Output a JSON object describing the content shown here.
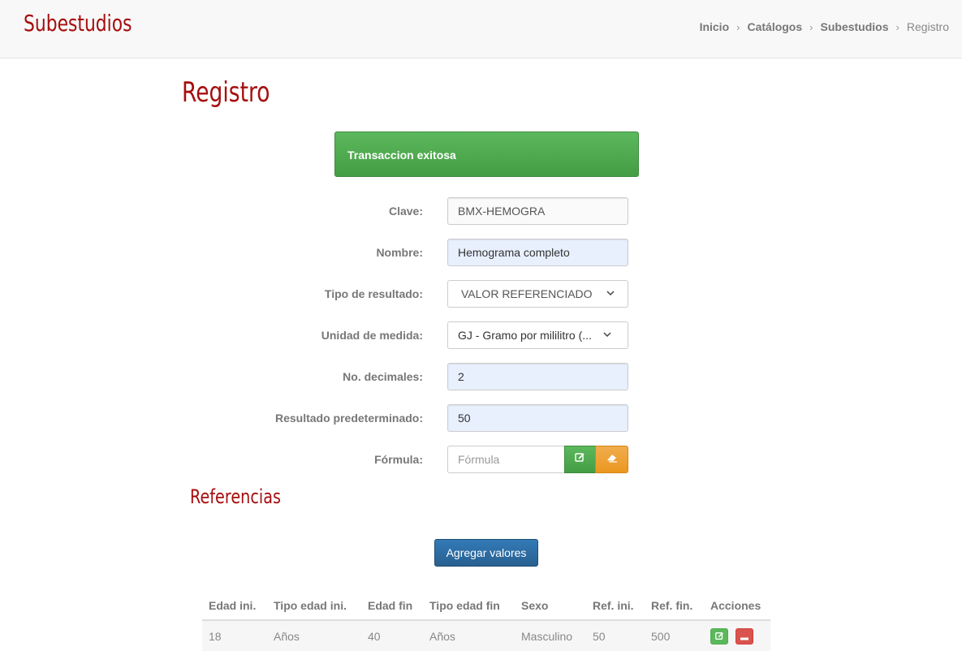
{
  "header": {
    "app_title": "Subestudios",
    "breadcrumb": [
      "Inicio",
      "Catálogos",
      "Subestudios",
      "Registro"
    ]
  },
  "page_title": "Registro",
  "alert": {
    "message": "Transaccion exitosa",
    "color": "#5cb85c"
  },
  "form": {
    "clave": {
      "label": "Clave:",
      "value": "BMX-HEMOGRA"
    },
    "nombre": {
      "label": "Nombre:",
      "value": "Hemograma completo"
    },
    "tipo_resultado": {
      "label": "Tipo de resultado:",
      "value": "VALOR REFERENCIADO"
    },
    "unidad_medida": {
      "label": "Unidad de medida:",
      "value": "GJ - Gramo por mililitro (..."
    },
    "decimales": {
      "label": "No. decimales:",
      "value": "2"
    },
    "resultado_predeterminado": {
      "label": "Resultado predeterminado:",
      "value": "50"
    },
    "formula": {
      "label": "Fórmula:",
      "placeholder": "Fórmula"
    }
  },
  "referencias": {
    "title": "Referencias",
    "add_button": "Agregar valores",
    "columns": [
      "Edad ini.",
      "Tipo edad ini.",
      "Edad fin",
      "Tipo edad fin",
      "Sexo",
      "Ref. ini.",
      "Ref. fin.",
      "Acciones"
    ],
    "rows": [
      [
        "18",
        "Años",
        "40",
        "Años",
        "Masculino",
        "50",
        "500"
      ]
    ]
  },
  "colors": {
    "brand_red": "#a70e0e",
    "success": "#5cb85c",
    "warning": "#f0ad4e",
    "primary": "#337ab7",
    "danger": "#d9534f"
  }
}
